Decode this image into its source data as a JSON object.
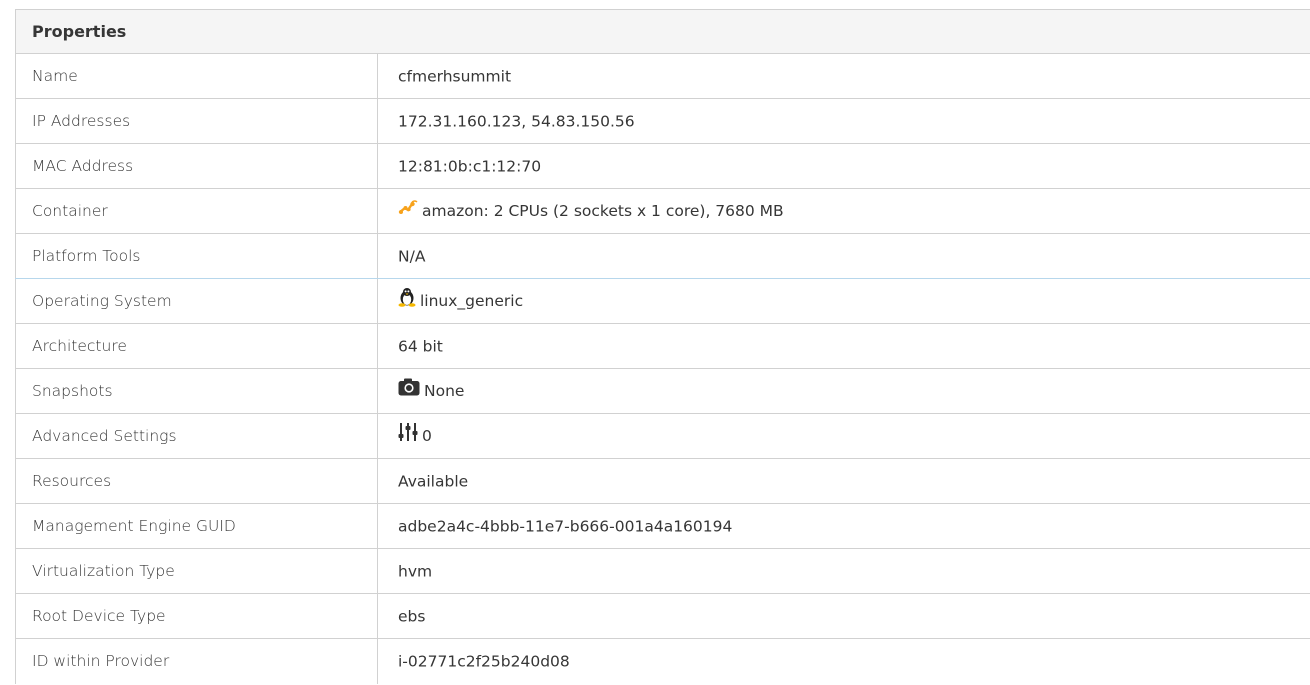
{
  "properties": {
    "header": "Properties",
    "rows": [
      {
        "label": "Name",
        "value": "cfmerhsummit"
      },
      {
        "label": "IP Addresses",
        "value": "172.31.160.123, 54.83.150.56"
      },
      {
        "label": "MAC Address",
        "value": "12:81:0b:c1:12:70"
      },
      {
        "label": "Container",
        "value": "amazon: 2 CPUs (2 sockets x 1 core), 7680 MB",
        "icon": "amazon-icon"
      },
      {
        "label": "Platform Tools",
        "value": "N/A"
      },
      {
        "label": "Operating System",
        "value": "linux_generic",
        "icon": "linux-tux-icon"
      },
      {
        "label": "Architecture",
        "value": "64 bit"
      },
      {
        "label": "Snapshots",
        "value": "None",
        "icon": "camera-icon"
      },
      {
        "label": "Advanced Settings",
        "value": "0",
        "icon": "sliders-icon"
      },
      {
        "label": "Resources",
        "value": "Available"
      },
      {
        "label": "Management Engine GUID",
        "value": "adbe2a4c-4bbb-11e7-b666-001a4a160194"
      },
      {
        "label": "Virtualization Type",
        "value": "hvm"
      },
      {
        "label": "Root Device Type",
        "value": "ebs"
      },
      {
        "label": "ID within Provider",
        "value": "i-02771c2f25b240d08"
      }
    ]
  },
  "colors": {
    "border": "#d1d1d1",
    "header_bg": "#f5f5f5",
    "highlight_border": "#b7d7ec",
    "amazon_orange": "#f7a21b"
  }
}
